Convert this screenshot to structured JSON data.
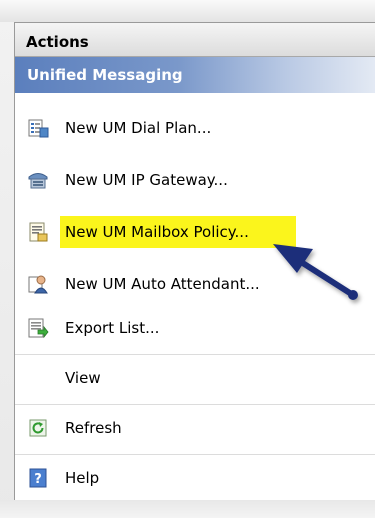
{
  "panel": {
    "title": "Actions",
    "section": "Unified Messaging"
  },
  "items": [
    {
      "label": "New UM Dial Plan...",
      "icon": "dial-plan-icon"
    },
    {
      "label": "New UM IP Gateway...",
      "icon": "ip-gateway-icon"
    },
    {
      "label": "New UM Mailbox Policy...",
      "icon": "mailbox-policy-icon",
      "highlighted": true
    },
    {
      "label": "New UM Auto Attendant...",
      "icon": "auto-attendant-icon"
    },
    {
      "label": "Export List...",
      "icon": "export-list-icon"
    },
    {
      "label": "View",
      "icon": ""
    },
    {
      "label": "Refresh",
      "icon": "refresh-icon"
    },
    {
      "label": "Help",
      "icon": "help-icon"
    }
  ],
  "colors": {
    "section_header": "#5b7fbd",
    "highlight": "#fbf51c",
    "arrow": "#1c2f7a"
  }
}
